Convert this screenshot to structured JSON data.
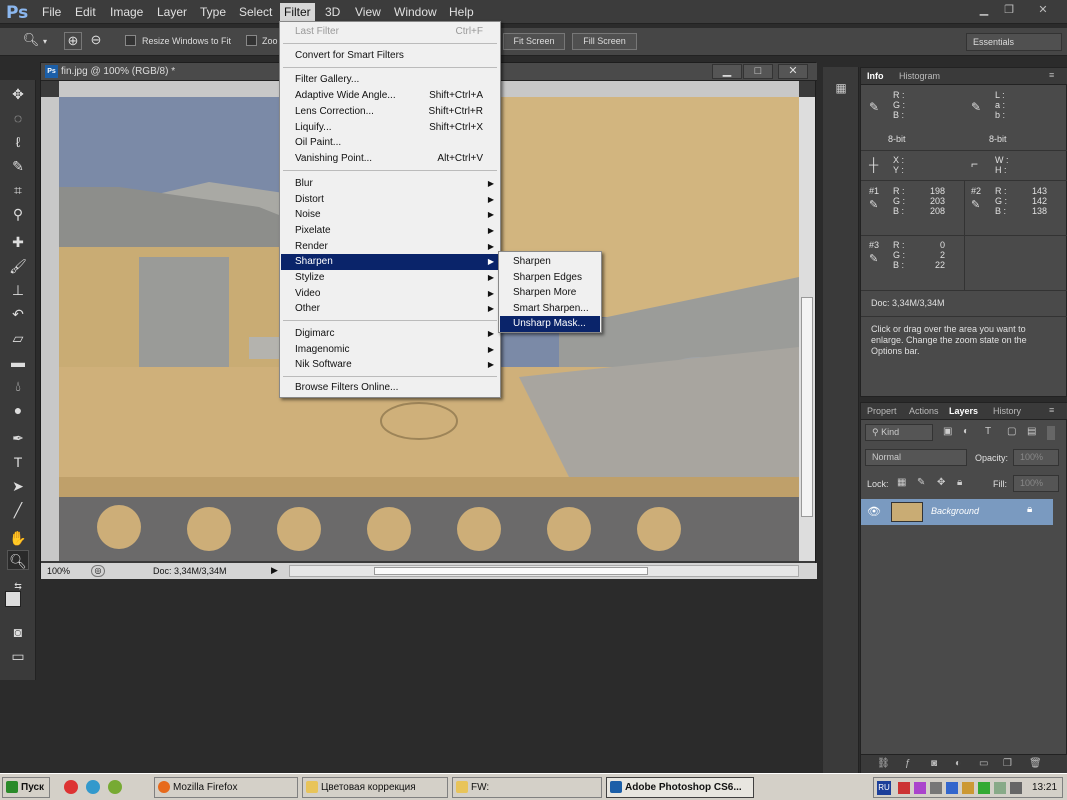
{
  "app": {
    "logo": "Ps"
  },
  "menubar": {
    "items": [
      "File",
      "Edit",
      "Image",
      "Layer",
      "Type",
      "Select",
      "Filter",
      "3D",
      "View",
      "Window",
      "Help"
    ],
    "active": "Filter"
  },
  "options": {
    "resize_label": "Resize Windows to Fit",
    "zoom_all_label": "Zoo",
    "fit_screen": "Fit Screen",
    "fill_screen": "Fill Screen",
    "workspace": "Essentials"
  },
  "document": {
    "title": "fin.jpg @ 100% (RGB/8) *",
    "zoom": "100%",
    "doc_size": "Doc: 3,34M/3,34M"
  },
  "filter_menu": {
    "items": [
      {
        "label": "Last Filter",
        "shortcut": "Ctrl+F",
        "disabled": true
      },
      {
        "label": "Convert for Smart Filters"
      },
      {
        "label": "Filter Gallery..."
      },
      {
        "label": "Adaptive Wide Angle...",
        "shortcut": "Shift+Ctrl+A"
      },
      {
        "label": "Lens Correction...",
        "shortcut": "Shift+Ctrl+R"
      },
      {
        "label": "Liquify...",
        "shortcut": "Shift+Ctrl+X"
      },
      {
        "label": "Oil Paint..."
      },
      {
        "label": "Vanishing Point...",
        "shortcut": "Alt+Ctrl+V"
      },
      {
        "label": "Blur",
        "submenu": true
      },
      {
        "label": "Distort",
        "submenu": true
      },
      {
        "label": "Noise",
        "submenu": true
      },
      {
        "label": "Pixelate",
        "submenu": true
      },
      {
        "label": "Render",
        "submenu": true
      },
      {
        "label": "Sharpen",
        "submenu": true,
        "highlighted": true
      },
      {
        "label": "Stylize",
        "submenu": true
      },
      {
        "label": "Video",
        "submenu": true
      },
      {
        "label": "Other",
        "submenu": true
      },
      {
        "label": "Digimarc",
        "submenu": true
      },
      {
        "label": "Imagenomic",
        "submenu": true
      },
      {
        "label": "Nik Software",
        "submenu": true
      },
      {
        "label": "Browse Filters Online..."
      }
    ]
  },
  "sharpen_submenu": {
    "items": [
      "Sharpen",
      "Sharpen Edges",
      "Sharpen More",
      "Smart Sharpen...",
      "Unsharp Mask..."
    ],
    "highlighted": "Unsharp Mask..."
  },
  "info_panel": {
    "tabs": [
      "Info",
      "Histogram"
    ],
    "rgb_labels": [
      "R :",
      "G :",
      "B :"
    ],
    "lab_labels": [
      "L :",
      "a :",
      "b :"
    ],
    "bit_left": "8-bit",
    "bit_right": "8-bit",
    "xy_labels": [
      "X :",
      "Y :"
    ],
    "wh_labels": [
      "W :",
      "H :"
    ],
    "sample1": {
      "label": "#1",
      "r": "198",
      "g": "203",
      "b": "208"
    },
    "sample2": {
      "label": "#2",
      "r": "143",
      "g": "142",
      "b": "138"
    },
    "sample3": {
      "label": "#3",
      "r": "0",
      "g": "2",
      "b": "22"
    },
    "doc": "Doc: 3,34M/3,34M",
    "hint": "Click or drag over the area you want to enlarge. Change the zoom state on the Options bar."
  },
  "layers_panel": {
    "tabs": [
      "Propert",
      "Actions",
      "Layers",
      "History"
    ],
    "kind": "Kind",
    "blend_mode": "Normal",
    "opacity_label": "Opacity:",
    "opacity": "100%",
    "lock_label": "Lock:",
    "fill_label": "Fill:",
    "fill": "100%",
    "layer_name": "Background"
  },
  "taskbar": {
    "start": "Пуск",
    "buttons": [
      "Mozilla Firefox",
      "Цветовая коррекция",
      "FW:",
      "Adobe Photoshop CS6..."
    ],
    "lang": "RU",
    "clock": "13:21"
  }
}
